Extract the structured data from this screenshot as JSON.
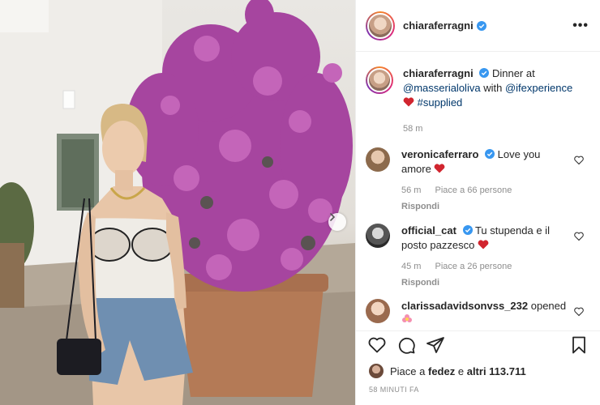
{
  "post": {
    "username": "chiaraferragni",
    "more_label": "•••"
  },
  "caption": {
    "username": "chiaraferragni",
    "text_1": "Dinner at",
    "mention_1": "@masserialoliva",
    "text_2": "with",
    "mention_2": "@ifexperience",
    "hashtag": "#supplied",
    "time": "58 m"
  },
  "comments": [
    {
      "username": "veronicaferraro",
      "text": "Love you amore",
      "time": "56 m",
      "likes": "Piace a 66 persone",
      "reply": "Rispondi"
    },
    {
      "username": "official_cat",
      "text": "Tu stupenda e il posto pazzesco",
      "time": "45 m",
      "likes": "Piace a 26 persone",
      "reply": "Rispondi"
    },
    {
      "username": "clarissadavidsonvss_232",
      "text": "opened"
    }
  ],
  "likes_bar": {
    "prefix": "Piace a",
    "user": "fedez",
    "middle": "e",
    "others": "altri 113.711"
  },
  "timestamp": "58 MINUTI FA",
  "colors": {
    "verified": "#3897f0",
    "heart": "#ed4956",
    "link": "#00376b",
    "muted": "#8e8e8e"
  },
  "icons": [
    "heart-icon",
    "comment-icon",
    "share-icon",
    "bookmark-icon",
    "verified-icon",
    "chevron-right-icon"
  ]
}
